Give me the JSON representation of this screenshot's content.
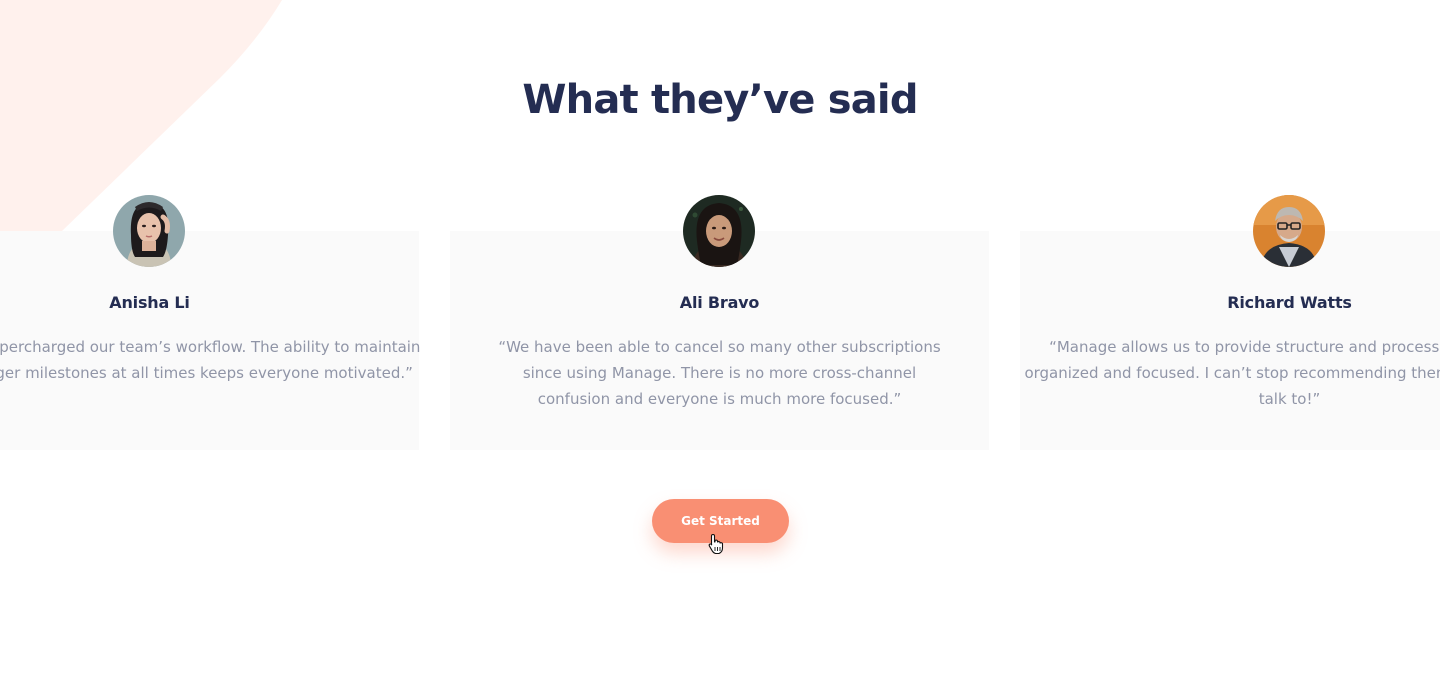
{
  "section": {
    "title": "What they’ve said"
  },
  "testimonials": [
    {
      "name": "Anisha Li",
      "quote": "“Manage has supercharged our team’s workflow. The ability to maintain visibility on larger milestones at all times keeps everyone motivated.”"
    },
    {
      "name": "Ali Bravo",
      "quote": "“We have been able to cancel so many other subscriptions since using Manage. There is no more cross-channel confusion and everyone is much more focused.”"
    },
    {
      "name": "Richard Watts",
      "quote": "“Manage allows us to provide structure and process. It keeps us organized and focused. I can’t stop recommending them to everyone I talk to!”"
    }
  ],
  "cta": {
    "label": "Get Started"
  },
  "colors": {
    "heading": "#242d52",
    "body_text": "#9095a7",
    "card_bg": "#fafafa",
    "accent": "#f98f73",
    "bg_shape": "#fff1ed"
  },
  "icons": {
    "cursor": "pointer-hand-icon"
  }
}
